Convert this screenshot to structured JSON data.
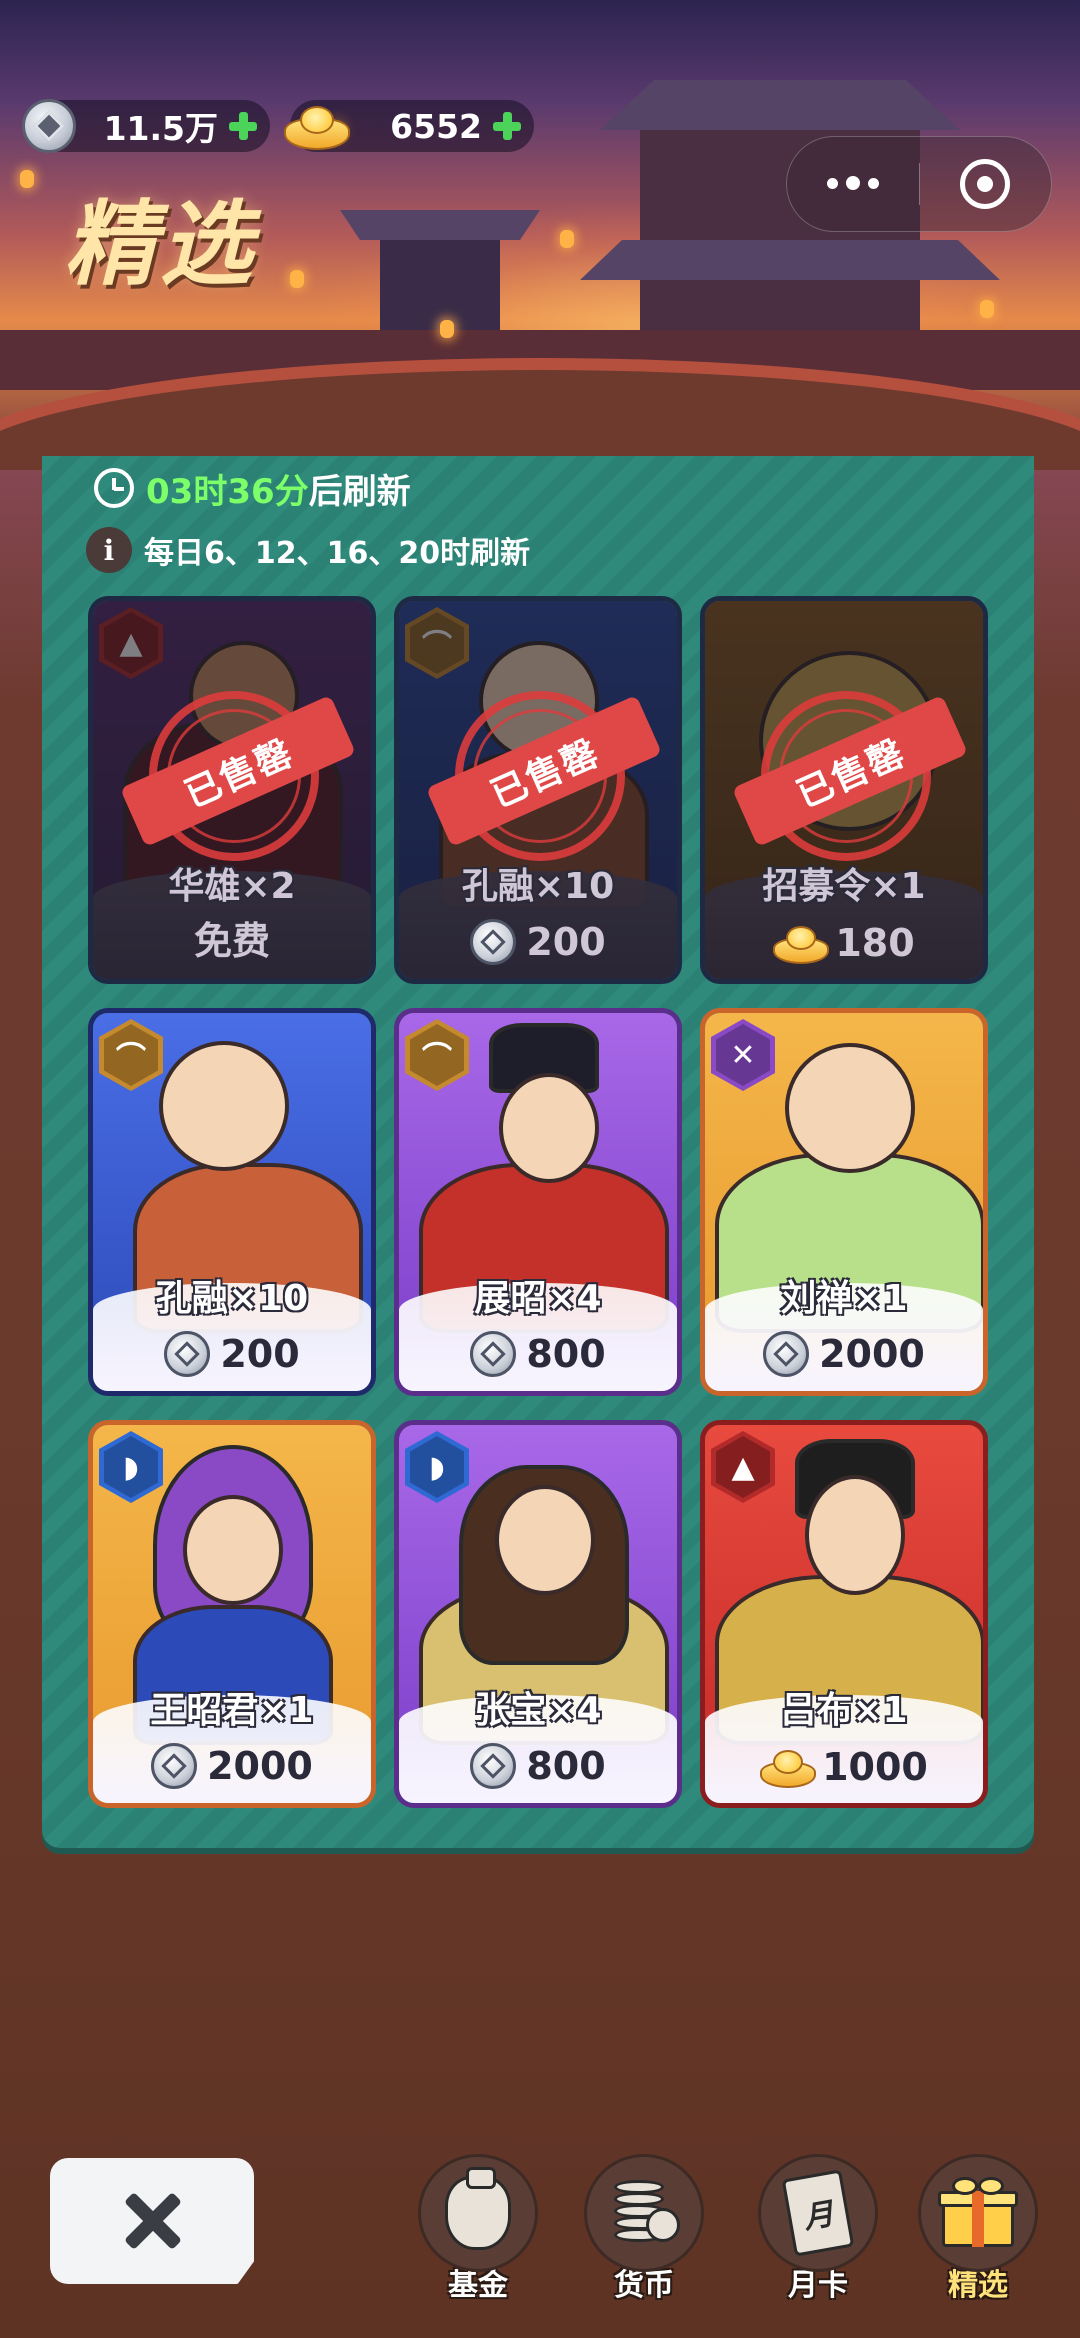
{
  "header": {
    "title": "精选",
    "silver": {
      "value": "11.5万",
      "icon": "silver-coin-icon"
    },
    "gold": {
      "value": "6552",
      "icon": "gold-ingot-icon"
    }
  },
  "panel": {
    "refresh_time": "03时36分",
    "refresh_suffix": "后刷新",
    "schedule": "每日6、12、16、20时刷新",
    "sold_label": "已售罄"
  },
  "cards": [
    {
      "name": "华雄×2",
      "price": "免费",
      "currency": "free",
      "sold": true,
      "badge": "blade-class-icon"
    },
    {
      "name": "孔融×10",
      "price": "200",
      "currency": "silver",
      "sold": true,
      "badge": "bow-class-icon"
    },
    {
      "name": "招募令×1",
      "price": "180",
      "currency": "gold",
      "sold": true,
      "badge": ""
    },
    {
      "name": "孔融×10",
      "price": "200",
      "currency": "silver",
      "sold": false,
      "badge": "bow-class-icon"
    },
    {
      "name": "展昭×4",
      "price": "800",
      "currency": "silver",
      "sold": false,
      "badge": "bow-class-icon"
    },
    {
      "name": "刘禅×1",
      "price": "2000",
      "currency": "silver",
      "sold": false,
      "badge": "crossed-swords-class-icon"
    },
    {
      "name": "王昭君×1",
      "price": "2000",
      "currency": "silver",
      "sold": false,
      "badge": "shield-class-icon"
    },
    {
      "name": "张宝×4",
      "price": "800",
      "currency": "silver",
      "sold": false,
      "badge": "shield-class-icon"
    },
    {
      "name": "吕布×1",
      "price": "1000",
      "currency": "gold",
      "sold": false,
      "badge": "blade-class-icon"
    }
  ],
  "tabs": [
    {
      "label": "基金",
      "icon": "fund-bag-icon"
    },
    {
      "label": "货币",
      "icon": "coin-stack-icon"
    },
    {
      "label": "月卡",
      "icon": "month-card-icon",
      "glyph": "月"
    },
    {
      "label": "精选",
      "icon": "gift-box-icon",
      "active": true
    }
  ],
  "colors": {
    "accent_green": "#7dff6a",
    "panel_teal": "#2f8a7c",
    "sold_red": "#e04848",
    "tab_active": "#ffe27a"
  }
}
